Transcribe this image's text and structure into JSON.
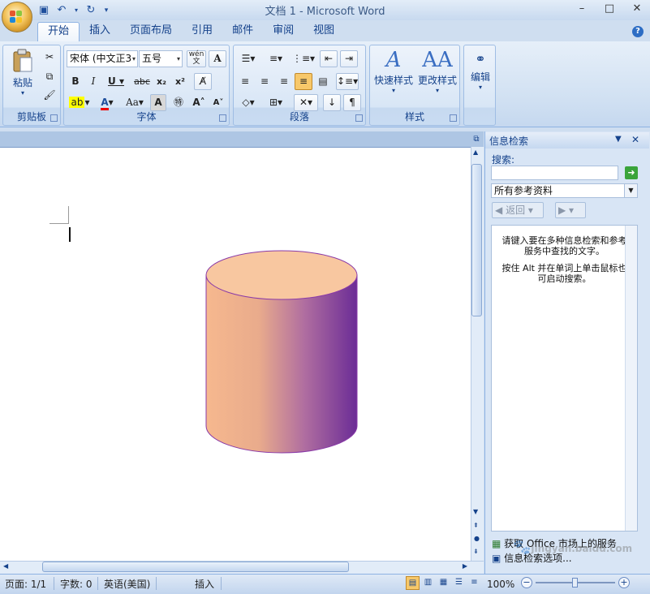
{
  "window": {
    "title": "文档 1 - Microsoft Word"
  },
  "tabs": [
    "开始",
    "插入",
    "页面布局",
    "引用",
    "邮件",
    "审阅",
    "视图"
  ],
  "ribbon": {
    "clipboard": {
      "label": "剪贴板",
      "paste": "粘贴"
    },
    "font": {
      "label": "字体",
      "font_name": "宋体 (中文正3",
      "font_size": "五号",
      "wen": "wén\n文",
      "aa": "Aa"
    },
    "paragraph": {
      "label": "段落"
    },
    "styles": {
      "label": "样式",
      "quick": "快速样式",
      "change": "更改样式"
    },
    "editing": {
      "label": "编辑"
    }
  },
  "pane": {
    "title": "信息检索",
    "search_label": "搜索:",
    "search_value": "",
    "source": "所有参考资料",
    "back": "返回",
    "hint1": "请键入要在多种信息检索和参考服务中查找的文字。",
    "hint2": "按住 Alt 并在单词上单击鼠标也可启动搜索。",
    "link1": "获取 Office 市场上的服务",
    "link2": "信息检索选项..."
  },
  "status": {
    "page": "页面: 1/1",
    "words": "字数: 0",
    "lang": "英语(美国)",
    "mode": "插入",
    "zoom": "100%"
  },
  "shape": {
    "type": "cylinder",
    "gradient_left": "#f6b88e",
    "gradient_right": "#6b2c96",
    "top_fill": "#f8c7a0",
    "stroke": "#8a3aa8"
  },
  "watermark": "jingyan.baidu.com"
}
